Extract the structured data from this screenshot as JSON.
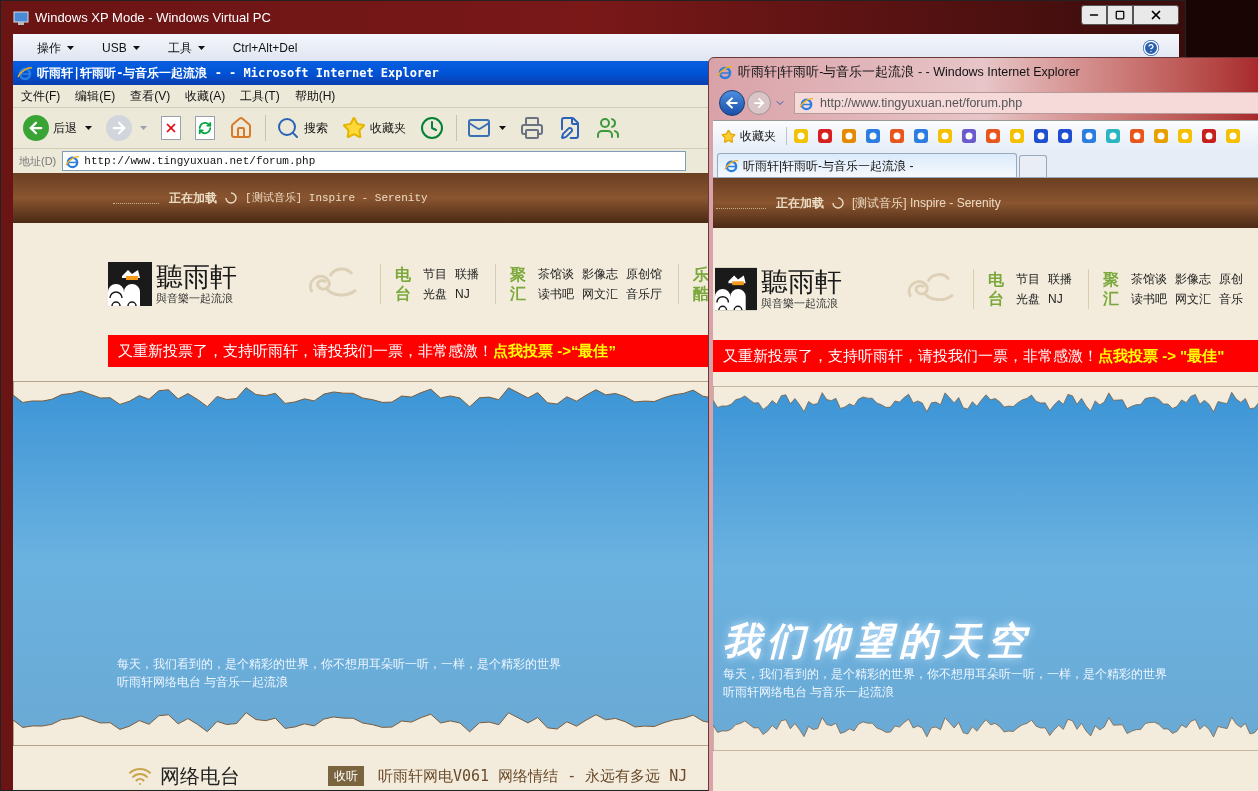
{
  "vpc_window": {
    "title": "Windows XP Mode - Windows Virtual PC",
    "menu": [
      {
        "label": "操作",
        "has_dropdown": true
      },
      {
        "label": "USB",
        "has_dropdown": true
      },
      {
        "label": "工具",
        "has_dropdown": true
      },
      {
        "label": "Ctrl+Alt+Del",
        "has_dropdown": false
      }
    ]
  },
  "xp_ie": {
    "title": "听雨轩|轩雨听-与音乐一起流浪 - - Microsoft Internet Explorer",
    "menu": [
      "文件(F)",
      "编辑(E)",
      "查看(V)",
      "收藏(A)",
      "工具(T)",
      "帮助(H)"
    ],
    "toolbar": [
      {
        "kind": "back",
        "label": "后退",
        "dropdown": true,
        "disabled": false
      },
      {
        "kind": "forward",
        "dropdown": true,
        "disabled": true
      },
      {
        "kind": "stop",
        "dropdown": false
      },
      {
        "kind": "refresh",
        "dropdown": false
      },
      {
        "kind": "home",
        "dropdown": false
      },
      {
        "kind": "search",
        "label": "搜索",
        "dropdown": false
      },
      {
        "kind": "favorites",
        "label": "收藏夹",
        "dropdown": false
      },
      {
        "kind": "history",
        "dropdown": false
      },
      {
        "kind": "mail",
        "dropdown": true
      },
      {
        "kind": "print",
        "dropdown": false
      },
      {
        "kind": "edit",
        "dropdown": false
      },
      {
        "kind": "messenger",
        "dropdown": false
      }
    ],
    "address_label": "地址(D)",
    "url": "http://www.tingyuxuan.net/forum.php",
    "page": {
      "loading_label": "正在加载",
      "now_playing": "[测试音乐] Inspire - Serenity",
      "logo_title": "聽雨軒",
      "logo_tagline": "與音樂一起流浪",
      "nav_groups": [
        {
          "label": "电台",
          "items": [
            "节目",
            "联播",
            "光盘",
            "NJ"
          ]
        },
        {
          "label": "聚汇",
          "items": [
            "茶馆谈",
            "影像志",
            "原创馆",
            "读书吧",
            "网文汇",
            "音乐厅"
          ]
        },
        {
          "label": "乐酷"
        }
      ],
      "notice": "又重新投票了，支持听雨轩，请投我们一票，非常感激！",
      "notice_link": "点我投票 ->“最佳”",
      "sky_lines": [
        "每天，我们看到的，是个精彩的世界，你不想用耳朵听一听，一样，是个精彩的世界",
        "听雨轩网络电台 与音乐一起流浪"
      ],
      "section_title": "网络电台",
      "listen_badge": "收听",
      "on_air": "听雨轩网电V061 网络情结 - 永远有多远 NJ"
    }
  },
  "ie8": {
    "title": "听雨轩|轩雨听-与音乐一起流浪 - - Windows Internet Explorer",
    "url": "http://www.tingyuxuan.net/forum.php",
    "favorites_label": "收藏夹",
    "tabs": [
      {
        "label": "听雨轩|轩雨听-与音乐一起流浪 -",
        "selected": true
      }
    ],
    "page": {
      "loading_label": "正在加载",
      "now_playing": "[测试音乐] Inspire - Serenity",
      "logo_title": "聽雨軒",
      "logo_tagline": "與音樂一起流浪",
      "nav_groups": [
        {
          "label": "电台",
          "items": [
            "节目",
            "联播",
            "光盘",
            "NJ"
          ]
        },
        {
          "label": "聚汇",
          "items": [
            "茶馆谈",
            "影像志",
            "原创",
            "读书吧",
            "网文汇",
            "音乐"
          ]
        }
      ],
      "notice": "又重新投票了，支持听雨轩，请投我们一票，非常感激！",
      "notice_link": "点我投票 -> \"最佳\"",
      "sky_title": "我们仰望的天空",
      "sky_lines": [
        "每天，我们看到的，是个精彩的世界，你不想用耳朵听一听，一样，是个精彩的世界",
        "听雨轩网络电台 与音乐一起流浪"
      ]
    }
  }
}
